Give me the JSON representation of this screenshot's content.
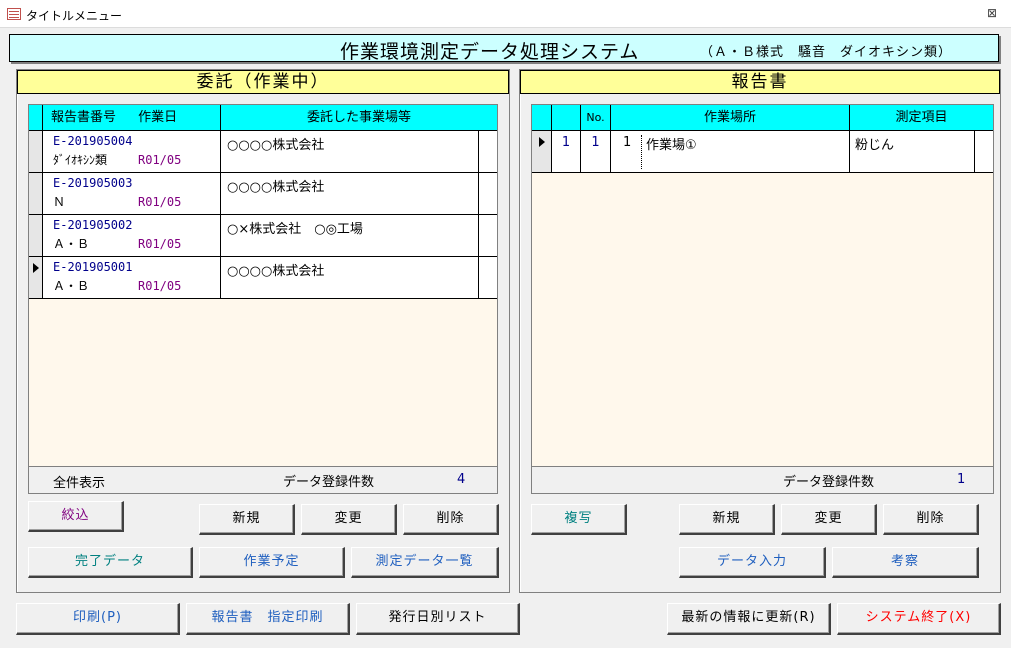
{
  "window": {
    "title": "タイトルメニュー",
    "close_glyph": "⊠"
  },
  "banner": {
    "title": "作業環境測定データ処理システム",
    "subtitle": "（Ａ・Ｂ様式　騒音　ダイオキシン類）"
  },
  "left_panel": {
    "header": "委託（作業中）",
    "columns": {
      "report_no": "報告書番号",
      "work_date": "作業日",
      "client": "委託した事業場等"
    },
    "rows": [
      {
        "number": "E-201905004",
        "type": "ﾀﾞｲｵｷｼﾝ類",
        "date": "R01/05",
        "client": "○○○○株式会社"
      },
      {
        "number": "E-201905003",
        "type": "Ｎ",
        "date": "R01/05",
        "client": "○○○○株式会社"
      },
      {
        "number": "E-201905002",
        "type": "Ａ・Ｂ",
        "date": "R01/05",
        "client": "○×株式会社　○◎工場"
      },
      {
        "number": "E-201905001",
        "type": "Ａ・Ｂ",
        "date": "R01/05",
        "client": "○○○○株式会社"
      }
    ],
    "footer": {
      "show_all": "全件表示",
      "count_label": "データ登録件数",
      "count": "4"
    },
    "buttons": {
      "filter": "絞込",
      "new": "新規",
      "edit": "変更",
      "delete": "削除",
      "completed": "完了データ",
      "scheduled": "作業予定",
      "measurement_list": "測定データ一覧"
    }
  },
  "right_panel": {
    "header": "報告書",
    "columns": {
      "no": "No.",
      "place": "作業場所",
      "item": "測定項目"
    },
    "rows": [
      {
        "id": "1",
        "no": "1",
        "seq": "1",
        "place": "作業場①",
        "item": "粉じん"
      }
    ],
    "footer": {
      "count_label": "データ登録件数",
      "count": "1"
    },
    "buttons": {
      "copy": "複写",
      "new": "新規",
      "edit": "変更",
      "delete": "削除",
      "data_entry": "データ入力",
      "review": "考察"
    }
  },
  "bottom_buttons": {
    "print": "印刷(P)",
    "report_print": "報告書　指定印刷",
    "issue_date_list": "発行日別リスト",
    "refresh": "最新の情報に更新(R)",
    "exit": "システム終了(X)"
  },
  "colors": {
    "banner_bg": "#ccffff",
    "panel_header_bg": "#ffff99",
    "grid_header_bg": "#00ffff",
    "grid_bg": "#fff8ec",
    "number_text": "#00008b",
    "date_text": "#800080",
    "filter_text": "#800080",
    "teal_text": "#008080",
    "blue_text": "#1f5fbf",
    "exit_text": "#ff0000"
  }
}
